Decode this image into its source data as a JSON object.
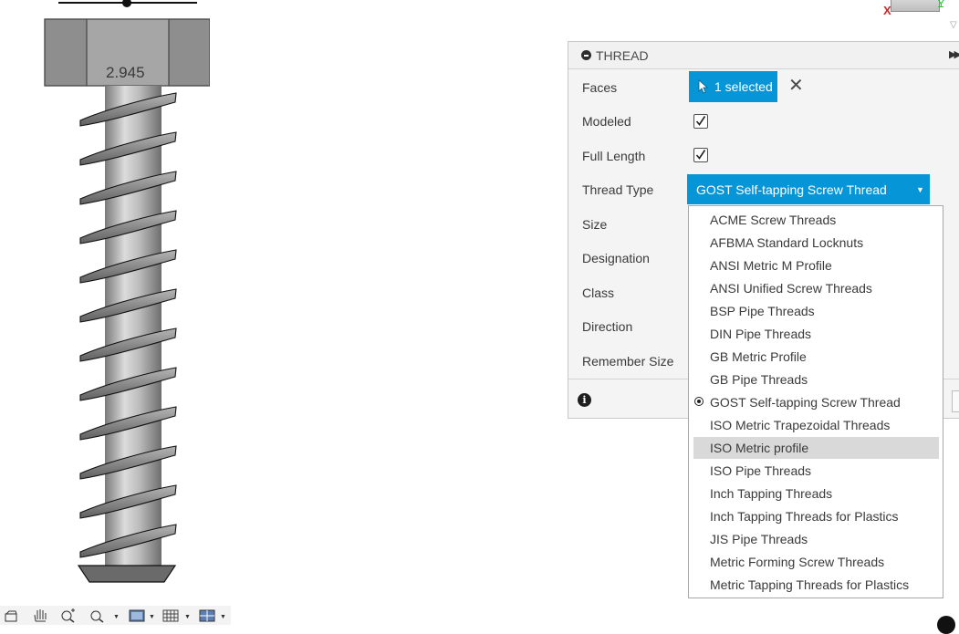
{
  "viewport": {
    "dimension_label": "2.945",
    "axes": {
      "x": "X",
      "y": "Y"
    }
  },
  "thread_panel": {
    "title": "THREAD",
    "rows": {
      "faces_label": "Faces",
      "faces_value": "1 selected",
      "modeled_label": "Modeled",
      "modeled_checked": true,
      "full_length_label": "Full Length",
      "full_length_checked": true,
      "thread_type_label": "Thread Type",
      "thread_type_value": "GOST Self-tapping Screw Thread",
      "size_label": "Size",
      "designation_label": "Designation",
      "class_label": "Class",
      "direction_label": "Direction",
      "remember_size_label": "Remember Size"
    }
  },
  "thread_type_dropdown": {
    "selected": "GOST Self-tapping Screw Thread",
    "hovered": "ISO Metric profile",
    "options": [
      "ACME Screw Threads",
      "AFBMA Standard Locknuts",
      "ANSI Metric M Profile",
      "ANSI Unified Screw Threads",
      "BSP Pipe Threads",
      "DIN Pipe Threads",
      "GB Metric Profile",
      "GB Pipe Threads",
      "GOST Self-tapping Screw Thread",
      "ISO Metric Trapezoidal Threads",
      "ISO Metric profile",
      "ISO Pipe Threads",
      "Inch Tapping Threads",
      "Inch Tapping Threads for Plastics",
      "JIS Pipe Threads",
      "Metric Forming Screw Threads",
      "Metric Tapping Threads for Plastics"
    ]
  },
  "colors": {
    "accent": "#0696d7",
    "panel_bg": "#f4f4f4",
    "highlight": "#d9d9d9",
    "model_gray": "#9e9e9e"
  },
  "icons": [
    "collapse-circle-icon",
    "expand-arrows-icon",
    "cursor-icon",
    "close-icon",
    "checkmark-icon",
    "dropdown-caret-icon",
    "radio-selected-icon",
    "info-icon",
    "orbit-icon",
    "pan-hand-icon",
    "zoom-fit-icon",
    "zoom-window-icon",
    "display-mode-icon",
    "grid-icon",
    "viewports-icon"
  ]
}
